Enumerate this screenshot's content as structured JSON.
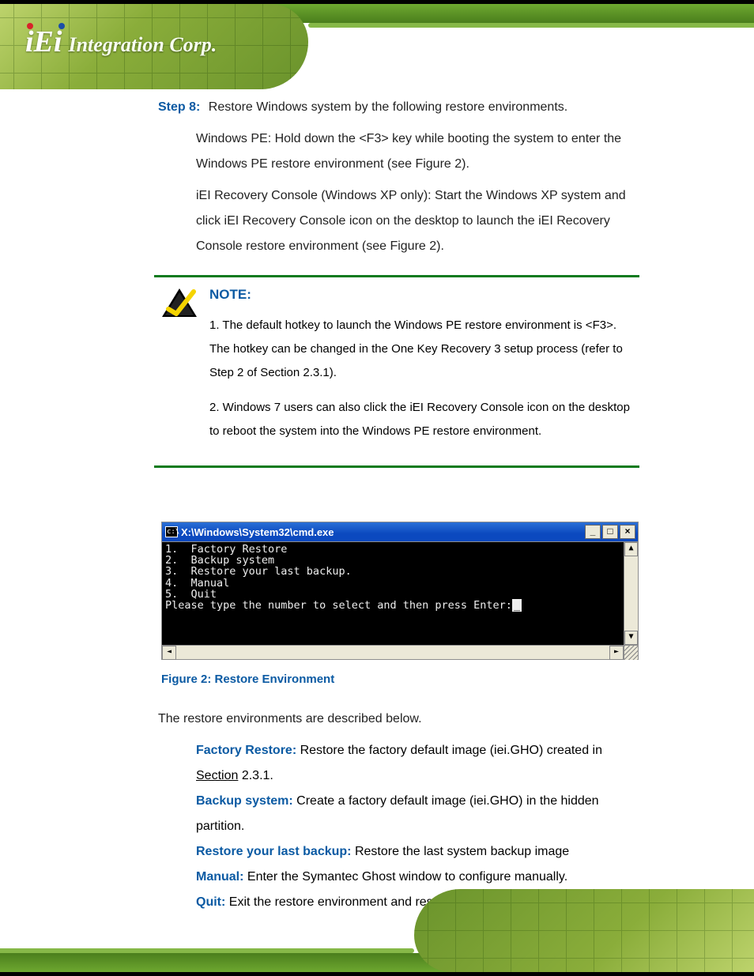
{
  "header": {
    "logo_mark": "iEi",
    "logo_text": "Integration Corp."
  },
  "steps": {
    "step8_label": "Step 8:",
    "step8_text": "Restore Windows system by the following restore environments.",
    "step8_a": "Windows PE: Hold down the <F3> key while booting the system to enter the Windows PE restore environment (see Figure 2).",
    "step8_b": "iEI Recovery Console (Windows XP only): Start the Windows XP system and click iEI Recovery Console icon on the desktop to launch the iEI Recovery Console restore environment (see Figure 2)."
  },
  "note": {
    "title": "NOTE:",
    "p1": "1. The default hotkey to launch the Windows PE restore environment is <F3>. The hotkey can be changed in the One Key Recovery 3 setup process (refer to Step 2 of Section 2.3.1).",
    "p2": "2. Windows 7 users can also click the iEI Recovery Console icon on the desktop to reboot the system into the Windows PE restore environment."
  },
  "cmd": {
    "title": "X:\\Windows\\System32\\cmd.exe",
    "line1": "1.  Factory Restore",
    "line2": "2.  Backup system",
    "line3": "3.  Restore your last backup.",
    "line4": "4.  Manual",
    "line5": "5.  Quit",
    "line6": "Please type the number to select and then press Enter:",
    "buttons": {
      "min": "_",
      "max": "□",
      "close": "×"
    },
    "scroll": {
      "up": "▲",
      "down": "▼",
      "left": "◄",
      "right": "►"
    }
  },
  "figure_caption": "Figure 2: Restore Environment",
  "options": {
    "intro": "The restore environments are described below.",
    "o1": {
      "label": "Factory Restore:",
      "text": " Restore the factory default image (iei.GHO) created in Section 2.3.1."
    },
    "o2": {
      "label": "Backup system:",
      "text": " Create a factory default image (iei.GHO) in the hidden partition."
    },
    "o3": {
      "label": "Restore your last backup:",
      "text": " Restore the last system backup image"
    },
    "o4": {
      "label": "Manual:",
      "text": " Enter the Symantec Ghost window to configure manually."
    },
    "o5": {
      "label": "Quit:",
      "text": " Exit the restore environment and restart the system."
    }
  }
}
